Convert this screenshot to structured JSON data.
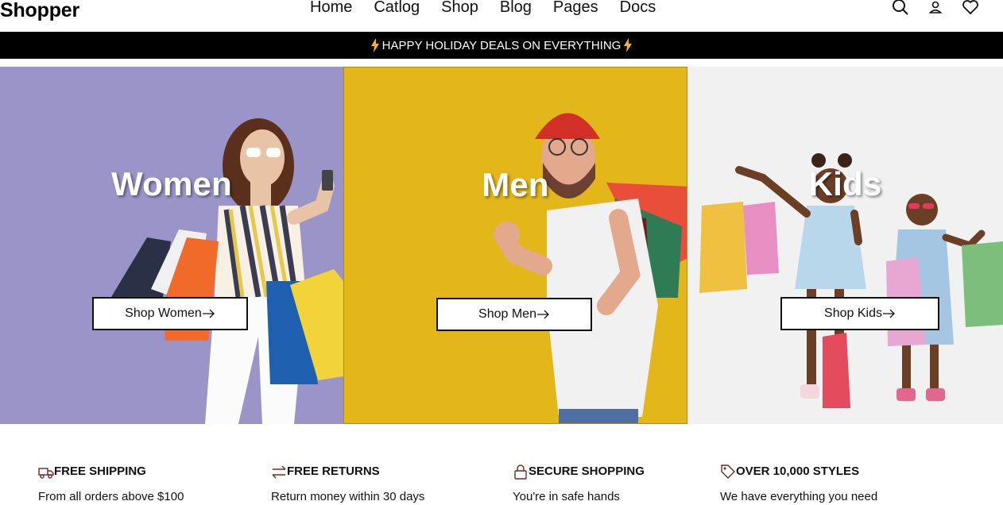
{
  "header": {
    "logo": "Shopper",
    "nav": [
      "Home",
      "Catlog",
      "Shop",
      "Blog",
      "Pages",
      "Docs"
    ],
    "icons": [
      "search-icon",
      "user-icon",
      "heart-icon"
    ]
  },
  "announcement": {
    "text": "HAPPY HOLIDAY DEALS ON EVERYTHING",
    "icon": "lightning-icon",
    "icon_color": "#f5b51f"
  },
  "panels": [
    {
      "title": "Women",
      "button": "Shop Women",
      "background": "#9b94c8"
    },
    {
      "title": "Men",
      "button": "Shop Men",
      "background": "#e3b71a"
    },
    {
      "title": "Kids",
      "button": "Shop Kids",
      "background": "#f1f1f1"
    }
  ],
  "features": [
    {
      "title": "FREE SHIPPING",
      "desc": "From all orders above $100",
      "icon": "truck-icon"
    },
    {
      "title": "FREE RETURNS",
      "desc": "Return money within 30 days",
      "icon": "exchange-icon"
    },
    {
      "title": "SECURE SHOPPING",
      "desc": "You're in safe hands",
      "icon": "lock-icon"
    },
    {
      "title": "OVER 10,000 STYLES",
      "desc": "We have everything you need",
      "icon": "tag-icon"
    }
  ]
}
